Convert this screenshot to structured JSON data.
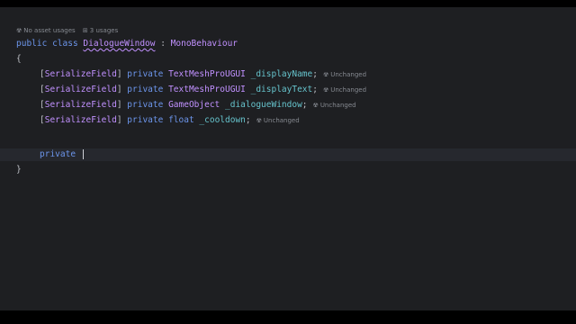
{
  "hints": {
    "usages_icon": "unity-usage-icon",
    "no_asset_usages": "No asset usages",
    "usages_count_icon": "usages-count-icon",
    "usages": "3 usages"
  },
  "code": {
    "kw_public": "public",
    "kw_class": "class",
    "class_name": "DialogueWindow",
    "colon": " : ",
    "base_class": "MonoBehaviour",
    "open_brace": "{",
    "close_brace": "}",
    "fields": [
      {
        "attr_open": "[",
        "attr": "SerializeField",
        "attr_close": "]",
        "access": "private",
        "type": "TextMeshProUGUI",
        "name": "_displayName",
        "semi": ";",
        "hint": "Unchanged"
      },
      {
        "attr_open": "[",
        "attr": "SerializeField",
        "attr_close": "]",
        "access": "private",
        "type": "TextMeshProUGUI",
        "name": "_displayText",
        "semi": ";",
        "hint": "Unchanged"
      },
      {
        "attr_open": "[",
        "attr": "SerializeField",
        "attr_close": "]",
        "access": "private",
        "type": "GameObject",
        "name": "_dialogueWindow",
        "semi": ";",
        "hint": "Unchanged"
      },
      {
        "attr_open": "[",
        "attr": "SerializeField",
        "attr_close": "]",
        "access": "private",
        "keyword_type": "float",
        "name": "_cooldown",
        "semi": ";",
        "hint": "Unchanged"
      }
    ],
    "typing_line": "private"
  },
  "colors": {
    "background": "#1e1f22",
    "keyword": "#6c95eb",
    "class": "#c191ff",
    "field": "#66c3cc",
    "text": "#bcbec4",
    "hint": "#868a91"
  }
}
